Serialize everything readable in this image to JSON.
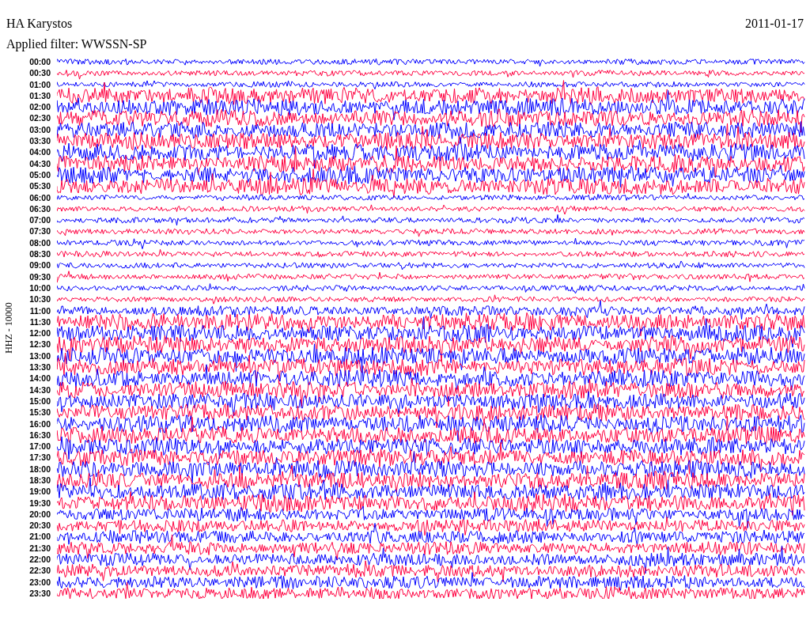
{
  "station": "HA Karystos",
  "date": "2011-01-17",
  "filter": "Applied filter: WWSSN-SP",
  "axis_label": "HHZ - 10000",
  "rows": [
    {
      "time": "00:00",
      "color": "#0000ff"
    },
    {
      "time": "00:30",
      "color": "#ff0040"
    },
    {
      "time": "01:00",
      "color": "#0000ff"
    },
    {
      "time": "01:30",
      "color": "#ff0040"
    },
    {
      "time": "02:00",
      "color": "#0000ff"
    },
    {
      "time": "02:30",
      "color": "#ff0040"
    },
    {
      "time": "03:00",
      "color": "#0000ff"
    },
    {
      "time": "03:30",
      "color": "#ff0040"
    },
    {
      "time": "04:00",
      "color": "#0000ff"
    },
    {
      "time": "04:30",
      "color": "#ff0040"
    },
    {
      "time": "05:00",
      "color": "#0000ff"
    },
    {
      "time": "05:30",
      "color": "#ff0040"
    },
    {
      "time": "06:00",
      "color": "#0000ff"
    },
    {
      "time": "06:30",
      "color": "#ff0040"
    },
    {
      "time": "07:00",
      "color": "#0000ff"
    },
    {
      "time": "07:30",
      "color": "#ff0040"
    },
    {
      "time": "08:00",
      "color": "#0000ff"
    },
    {
      "time": "08:30",
      "color": "#ff0040"
    },
    {
      "time": "09:00",
      "color": "#0000ff"
    },
    {
      "time": "09:30",
      "color": "#ff0040"
    },
    {
      "time": "10:00",
      "color": "#0000ff"
    },
    {
      "time": "10:30",
      "color": "#ff0040"
    },
    {
      "time": "11:00",
      "color": "#0000ff"
    },
    {
      "time": "11:30",
      "color": "#ff0040"
    },
    {
      "time": "12:00",
      "color": "#0000ff"
    },
    {
      "time": "12:30",
      "color": "#ff0040"
    },
    {
      "time": "13:00",
      "color": "#0000ff"
    },
    {
      "time": "13:30",
      "color": "#ff0040"
    },
    {
      "time": "14:00",
      "color": "#0000ff"
    },
    {
      "time": "14:30",
      "color": "#ff0040"
    },
    {
      "time": "15:00",
      "color": "#0000ff"
    },
    {
      "time": "15:30",
      "color": "#ff0040"
    },
    {
      "time": "16:00",
      "color": "#0000ff"
    },
    {
      "time": "16:30",
      "color": "#ff0040"
    },
    {
      "time": "17:00",
      "color": "#0000ff"
    },
    {
      "time": "17:30",
      "color": "#ff0040"
    },
    {
      "time": "18:00",
      "color": "#0000ff"
    },
    {
      "time": "18:30",
      "color": "#ff0040"
    },
    {
      "time": "19:00",
      "color": "#0000ff"
    },
    {
      "time": "19:30",
      "color": "#ff0040"
    },
    {
      "time": "20:00",
      "color": "#0000ff"
    },
    {
      "time": "20:30",
      "color": "#ff0040"
    },
    {
      "time": "21:00",
      "color": "#0000ff"
    },
    {
      "time": "21:30",
      "color": "#ff0040"
    },
    {
      "time": "22:00",
      "color": "#0000ff"
    },
    {
      "time": "22:30",
      "color": "#ff0040"
    },
    {
      "time": "23:00",
      "color": "#0000ff"
    },
    {
      "time": "23:30",
      "color": "#ff0040"
    }
  ]
}
